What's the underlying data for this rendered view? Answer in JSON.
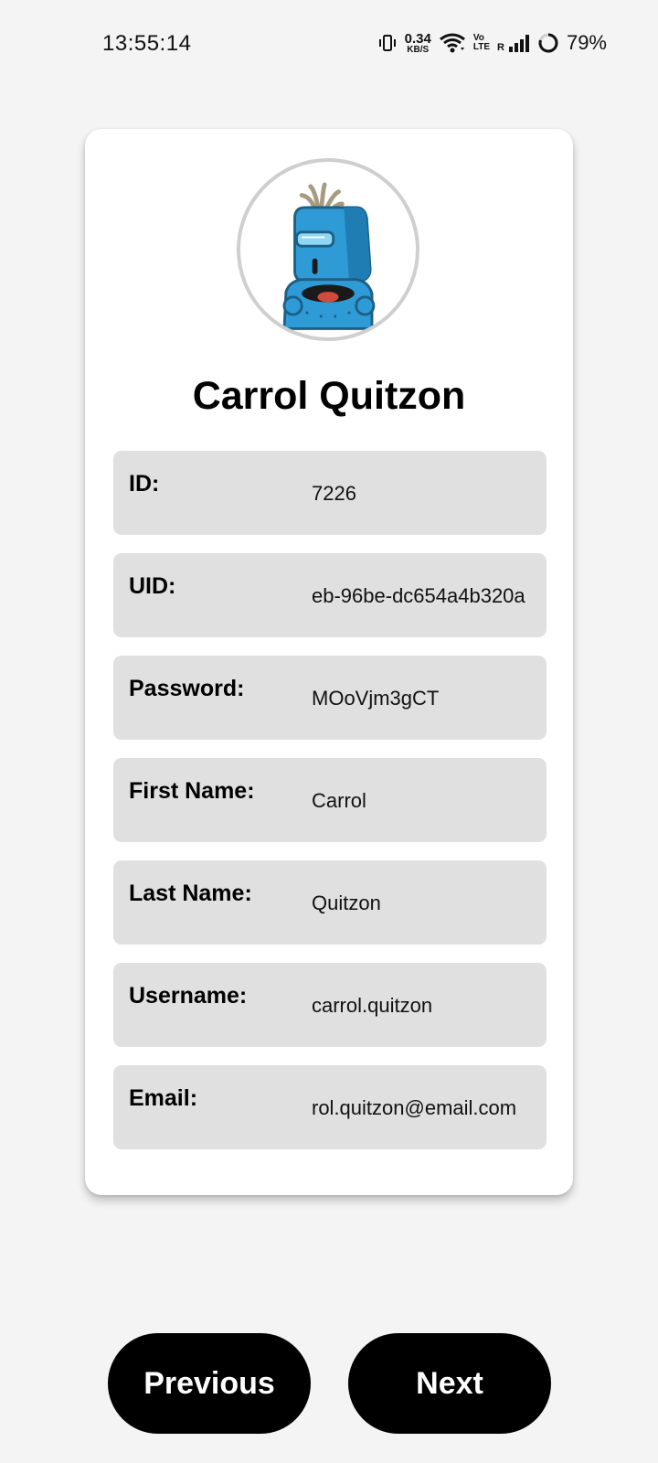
{
  "status_bar": {
    "time": "13:55:14",
    "net_speed_value": "0.34",
    "net_speed_unit": "KB/S",
    "volte_top": "Vo",
    "volte_bottom": "LTE",
    "roaming": "R",
    "battery_percent": "79%"
  },
  "profile": {
    "avatar_icon": "robot-avatar-icon",
    "full_name": "Carrol Quitzon"
  },
  "fields": [
    {
      "label": "ID:",
      "value": "7226"
    },
    {
      "label": "UID:",
      "value": "eb-96be-dc654a4b320a"
    },
    {
      "label": "Password:",
      "value": "MOoVjm3gCT"
    },
    {
      "label": "First Name:",
      "value": "Carrol"
    },
    {
      "label": "Last Name:",
      "value": "Quitzon"
    },
    {
      "label": "Username:",
      "value": "carrol.quitzon"
    },
    {
      "label": "Email:",
      "value": "rol.quitzon@email.com"
    }
  ],
  "buttons": {
    "previous": "Previous",
    "next": "Next"
  },
  "colors": {
    "background": "#f4f4f4",
    "card": "#ffffff",
    "field_bg": "#e0e0e0",
    "button_bg": "#000000",
    "button_text": "#ffffff",
    "avatar_blue": "#2f9bd6"
  }
}
